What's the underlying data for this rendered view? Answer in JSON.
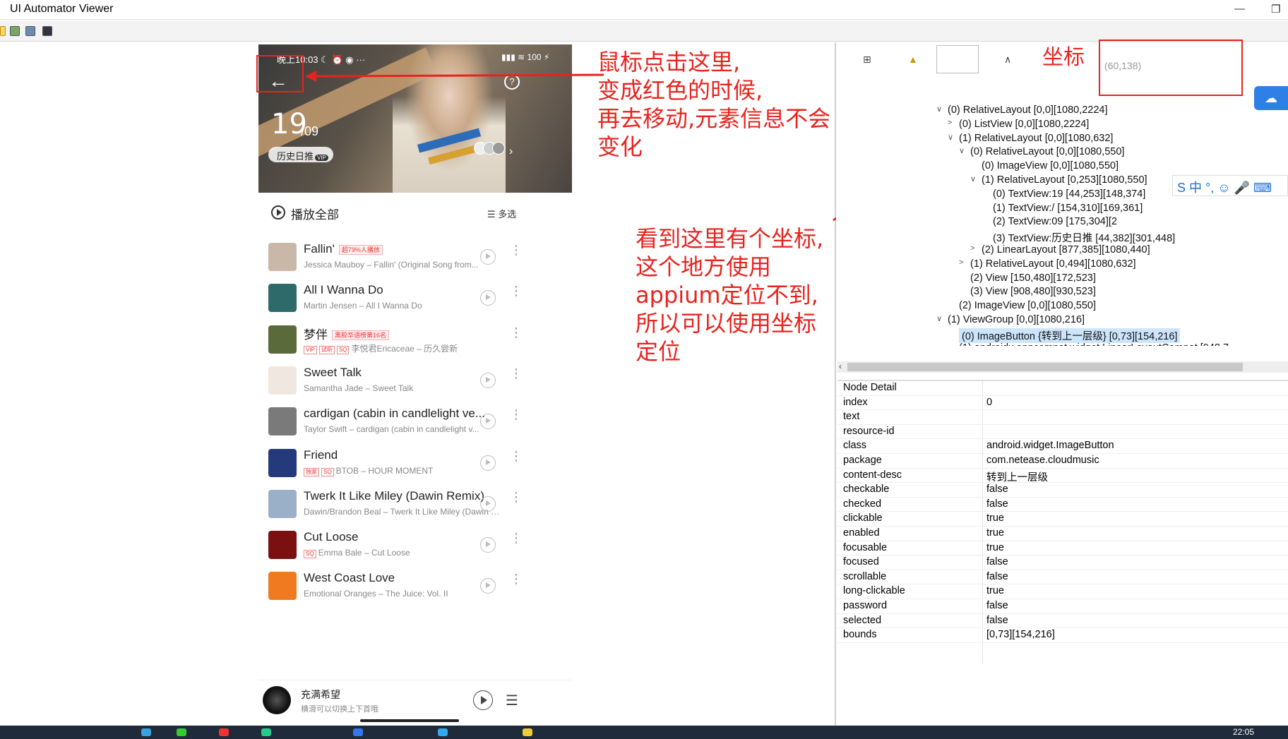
{
  "window": {
    "title": "UI Automator Viewer",
    "minimize": "—",
    "restore": "❐"
  },
  "phone": {
    "status_time": "晚上10:03",
    "status_icons": "☾ ⏰ ◉ ···",
    "status_right": "▮▮▮ ≋ 100 ⚡",
    "day": "19",
    "month": "/09",
    "history_label": "历史日推",
    "vip_badge": "VIP",
    "play_all": "播放全部",
    "multi_select": "☰ 多选",
    "songs": [
      {
        "title": "Fallin'",
        "tag": "超79%人播放",
        "sub": "Jessica Mauboy – Fallin' (Original Song from...",
        "marks": [],
        "color": "#c9b8a8"
      },
      {
        "title": "All I Wanna Do",
        "tag": "",
        "sub": "Martin Jensen – All I Wanna Do",
        "marks": [],
        "color": "#2f6a6a"
      },
      {
        "title": "梦伴",
        "tag": "黑胶华语榜第16名",
        "sub": "李悦君Ericaceae – 历久尝新",
        "marks": [
          "VIP",
          "试听",
          "SQ"
        ],
        "color": "#5a6a3a"
      },
      {
        "title": "Sweet Talk",
        "tag": "",
        "sub": "Samantha Jade – Sweet Talk",
        "marks": [],
        "color": "#f0e8e0"
      },
      {
        "title": "cardigan (cabin in candlelight ve...",
        "tag": "",
        "sub": "Taylor Swift – cardigan (cabin in candlelight v...",
        "marks": [],
        "color": "#7a7a7a"
      },
      {
        "title": "Friend",
        "tag": "",
        "sub": "BTOB – HOUR MOMENT",
        "marks": [
          "独家",
          "SQ"
        ],
        "color": "#243a7a"
      },
      {
        "title": "Twerk It Like Miley (Dawin Remix)",
        "tag": "",
        "sub": "Dawin/Brandon Beal – Twerk It Like Miley (Dawin Rem...",
        "marks": [],
        "color": "#9ab0c8"
      },
      {
        "title": "Cut Loose",
        "tag": "",
        "sub": "Emma Bale – Cut Loose",
        "marks": [
          "SQ"
        ],
        "color": "#7a1010"
      },
      {
        "title": "West Coast Love",
        "tag": "",
        "sub": "Emotional Oranges – The Juice: Vol. II",
        "marks": [],
        "color": "#f07a20"
      }
    ],
    "now_playing": {
      "title": "充满希望",
      "sub": "横滑可以切换上下首哦"
    }
  },
  "annotations": {
    "a1": [
      "鼠标点击这里,",
      "变成红色的时候,",
      "再去移动,元素信息不会变化"
    ],
    "a2": [
      "看到这里有个坐标,",
      "这个地方使用appium定位不到,",
      "所以可以使用坐标定位"
    ],
    "a3": "坐标"
  },
  "right": {
    "coord": "(60,138)",
    "tree": [
      {
        "text": "(0) RelativeLayout [0,0][1080,2224]",
        "indent": 0,
        "arrow": "∨"
      },
      {
        "text": "(0) ListView [0,0][1080,2224]",
        "indent": 1,
        "arrow": ">"
      },
      {
        "text": "(1) RelativeLayout [0,0][1080,632]",
        "indent": 1,
        "arrow": "∨"
      },
      {
        "text": "(0) RelativeLayout [0,0][1080,550]",
        "indent": 2,
        "arrow": "∨"
      },
      {
        "text": "(0) ImageView [0,0][1080,550]",
        "indent": 3,
        "arrow": ""
      },
      {
        "text": "(1) RelativeLayout [0,253][1080,550]",
        "indent": 3,
        "arrow": "∨"
      },
      {
        "text": "(0) TextView:19 [44,253][148,374]",
        "indent": 4,
        "arrow": ""
      },
      {
        "text": "(1) TextView:/ [154,310][169,361]",
        "indent": 4,
        "arrow": ""
      },
      {
        "text": "(2) TextView:09 [175,304][2",
        "indent": 4,
        "arrow": ""
      },
      {
        "text": "(3) TextView:历史日推 [44,382][301,448]",
        "indent": 4,
        "arrow": ""
      },
      {
        "text": "(2) LinearLayout [877,385][1080,440]",
        "indent": 3,
        "arrow": ">"
      },
      {
        "text": "(1) RelativeLayout [0,494][1080,632]",
        "indent": 2,
        "arrow": ">"
      },
      {
        "text": "(2) View [150,480][172,523]",
        "indent": 2,
        "arrow": ""
      },
      {
        "text": "(3) View [908,480][930,523]",
        "indent": 2,
        "arrow": ""
      },
      {
        "text": "(2) ImageView [0,0][1080,550]",
        "indent": 1,
        "arrow": ""
      },
      {
        "text": "(1) ViewGroup [0,0][1080,216]",
        "indent": 0,
        "arrow": "∨"
      },
      {
        "text": "(0) ImageButton {转到上一层级} [0,73][154,216]",
        "indent": 1,
        "arrow": "",
        "selected": true
      },
      {
        "text": "(1) androidx.appcompat.widget.LinearLayoutCompat [948,7",
        "indent": 1,
        "arrow": ""
      }
    ],
    "detail_title": "Node Detail",
    "details": [
      [
        "index",
        "0"
      ],
      [
        "text",
        ""
      ],
      [
        "resource-id",
        ""
      ],
      [
        "class",
        "android.widget.ImageButton"
      ],
      [
        "package",
        "com.netease.cloudmusic"
      ],
      [
        "content-desc",
        "转到上一层级"
      ],
      [
        "checkable",
        "false"
      ],
      [
        "checked",
        "false"
      ],
      [
        "clickable",
        "true"
      ],
      [
        "enabled",
        "true"
      ],
      [
        "focusable",
        "true"
      ],
      [
        "focused",
        "false"
      ],
      [
        "scrollable",
        "false"
      ],
      [
        "long-clickable",
        "true"
      ],
      [
        "password",
        "false"
      ],
      [
        "selected",
        "false"
      ],
      [
        "bounds",
        "[0,73][154,216]"
      ]
    ],
    "ime": "S 中 °, ☺ 🎤 ⌨",
    "cloud": "☁"
  },
  "taskbar": {
    "clock": "22:05"
  }
}
